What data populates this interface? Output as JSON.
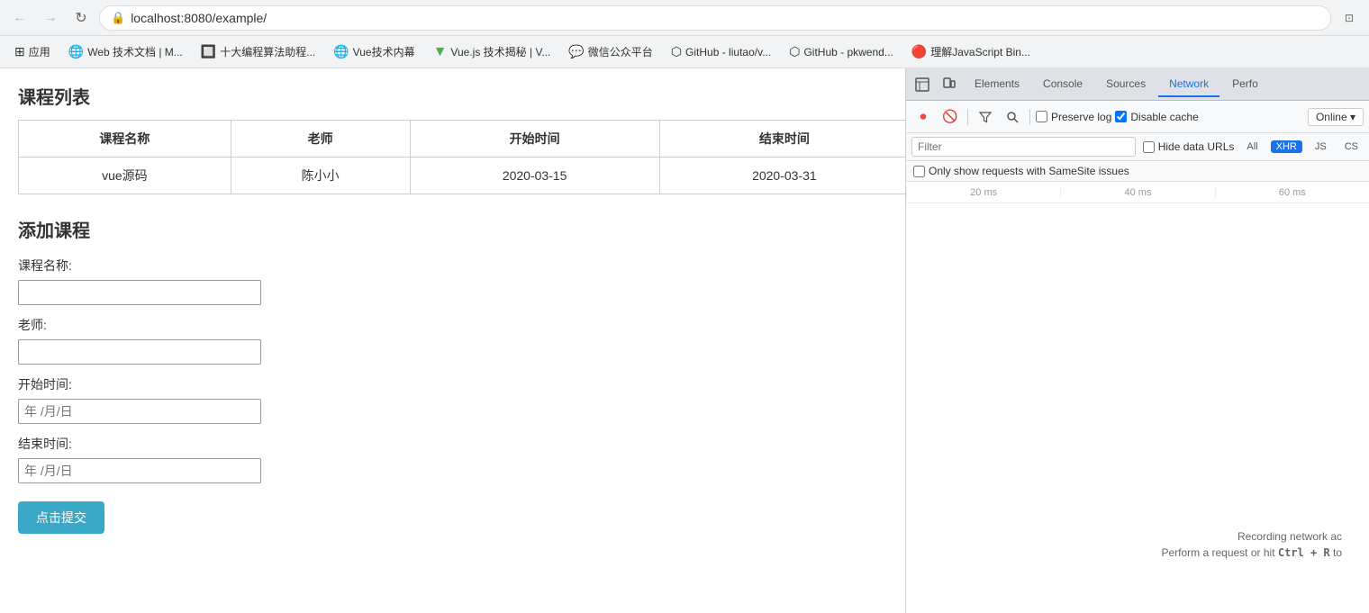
{
  "browser": {
    "url": "localhost:8080/example/",
    "nav": {
      "back_disabled": true,
      "forward_disabled": true,
      "back_label": "←",
      "forward_label": "→",
      "reload_label": "↻"
    },
    "bookmarks": [
      {
        "id": "apps",
        "icon": "⊞",
        "label": "应用"
      },
      {
        "id": "web-docs",
        "icon": "🌐",
        "label": "Web 技术文档 | M..."
      },
      {
        "id": "algorithms",
        "icon": "🔲",
        "label": "十大编程算法助程..."
      },
      {
        "id": "vue-inner",
        "icon": "🌐",
        "label": "Vue技术内幕"
      },
      {
        "id": "vuejs",
        "icon": "▼",
        "label": "Vue.js 技术揭秘 | V..."
      },
      {
        "id": "wechat",
        "icon": "💬",
        "label": "微信公众平台"
      },
      {
        "id": "github1",
        "icon": "⬡",
        "label": "GitHub - liutao/v..."
      },
      {
        "id": "github2",
        "icon": "⬡",
        "label": "GitHub - pkwend..."
      },
      {
        "id": "js-bin",
        "icon": "🔴",
        "label": "理解JavaScript Bin..."
      }
    ]
  },
  "page": {
    "course_list_title": "课程列表",
    "table": {
      "headers": [
        "课程名称",
        "老师",
        "开始时间",
        "结束时间"
      ],
      "rows": [
        [
          "vue源码",
          "陈小小",
          "2020-03-15",
          "2020-03-31"
        ]
      ]
    },
    "add_course_title": "添加课程",
    "form": {
      "course_name_label": "课程名称:",
      "course_name_placeholder": "",
      "teacher_label": "老师:",
      "teacher_placeholder": "",
      "start_time_label": "开始时间:",
      "start_time_placeholder": "年 /月/日",
      "end_time_label": "结束时间:",
      "end_time_placeholder": "年 /月/日",
      "submit_label": "点击提交"
    }
  },
  "devtools": {
    "tabs": [
      {
        "id": "elements",
        "label": "Elements",
        "active": false
      },
      {
        "id": "console",
        "label": "Console",
        "active": false
      },
      {
        "id": "sources",
        "label": "Sources",
        "active": false
      },
      {
        "id": "network",
        "label": "Network",
        "active": true
      },
      {
        "id": "performance",
        "label": "Perfo",
        "active": false
      }
    ],
    "toolbar": {
      "record_label": "⏺",
      "stop_label": "🚫",
      "filter_label": "▽",
      "search_label": "🔍",
      "preserve_log_label": "Preserve log",
      "disable_cache_label": "Disable cache",
      "online_label": "Online ▾"
    },
    "filter": {
      "placeholder": "Filter",
      "hide_data_urls_label": "Hide data URLs",
      "all_label": "All",
      "xhr_label": "XHR",
      "js_label": "JS",
      "css_label": "CS"
    },
    "samesite_label": "Only show requests with SameSite issues",
    "timeline": {
      "ticks": [
        "20 ms",
        "40 ms",
        "60 ms"
      ]
    },
    "empty_state": {
      "line1": "Recording network ac",
      "line2": "Perform a request or hit",
      "ctrl_r": "Ctrl + R",
      "line2_suffix": "to"
    }
  }
}
